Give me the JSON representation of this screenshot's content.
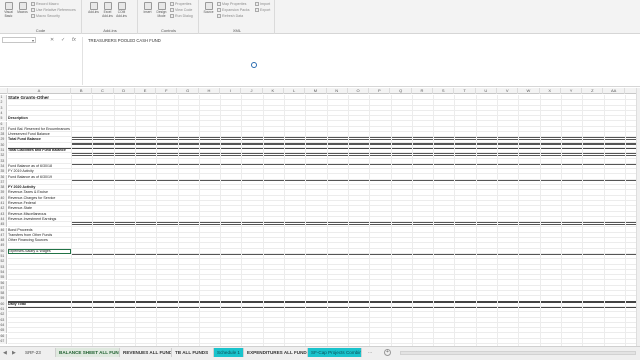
{
  "ribbon": {
    "groups": [
      {
        "name": "Code",
        "big": [
          "Visual Basic",
          "Macros"
        ],
        "small": [
          "Record Macro",
          "Use Relative References",
          "Macro Security"
        ]
      },
      {
        "name": "Add-ins",
        "big": [
          "Add-ins",
          "Excel Add-ins",
          "COM Add-ins"
        ],
        "small": []
      },
      {
        "name": "Controls",
        "big": [
          "Insert",
          "Design Mode"
        ],
        "small": [
          "Properties",
          "View Code",
          "Run Dialog"
        ]
      },
      {
        "name": "XML",
        "big": [
          "Source"
        ],
        "small": [
          "Map Properties",
          "Expansion Packs",
          "Refresh Data",
          "Import",
          "Export"
        ]
      }
    ]
  },
  "formula_bar": {
    "name_box": "",
    "cancel": "✕",
    "enter": "✓",
    "fx": "fx",
    "content": "TREASURERS POOLED CASH FUND"
  },
  "columns": [
    "A",
    "B",
    "C",
    "D",
    "E",
    "F",
    "G",
    "H",
    "I",
    "J",
    "K",
    "L",
    "M",
    "N",
    "O",
    "P",
    "Q",
    "R",
    "S",
    "T",
    "U",
    "V",
    "W",
    "X",
    "Y",
    "Z",
    "AA"
  ],
  "rows": [
    {
      "n": "1",
      "a": "State Grants-Other",
      "style": "title"
    },
    {
      "n": "2",
      "a": ""
    },
    {
      "n": "3",
      "a": ""
    },
    {
      "n": "4",
      "a": ""
    },
    {
      "n": "5",
      "a": "Description",
      "style": "bold"
    },
    {
      "n": "6",
      "a": ""
    },
    {
      "n": "27",
      "a": "Fund Bal. Reserved for Encumbrances"
    },
    {
      "n": "28",
      "a": "Unreserved Fund Balance"
    },
    {
      "n": "29",
      "a": "Total Fund Balance",
      "style": "bold"
    },
    {
      "n": "30",
      "a": ""
    },
    {
      "n": "31",
      "a": "Total Liabilities and Fund Balance",
      "style": "bold"
    },
    {
      "n": "32",
      "a": ""
    },
    {
      "n": "33",
      "a": ""
    },
    {
      "n": "34",
      "a": "Fund Balance as of 6/30/18"
    },
    {
      "n": "35",
      "a": "FY 2019 Activity"
    },
    {
      "n": "36",
      "a": "Fund Balance as of 6/30/19"
    },
    {
      "n": "37",
      "a": ""
    },
    {
      "n": "38",
      "a": "FY 2020 Activity",
      "style": "bold"
    },
    {
      "n": "39",
      "a": "Revenue-Taxes & Excise"
    },
    {
      "n": "40",
      "a": "Revenue-Charges for Service"
    },
    {
      "n": "41",
      "a": "Revenue-Federal"
    },
    {
      "n": "42",
      "a": "Revenue-State"
    },
    {
      "n": "43",
      "a": "Revenue-Miscellaneous"
    },
    {
      "n": "44",
      "a": "Revenue-Investment Earnings"
    },
    {
      "n": "45",
      "a": ""
    },
    {
      "n": "46",
      "a": "Bond Proceeds"
    },
    {
      "n": "47",
      "a": "Transfers from Other Funds"
    },
    {
      "n": "48",
      "a": "Other Financing Sources"
    },
    {
      "n": "49",
      "a": ""
    },
    {
      "n": "50",
      "a": "Expenses-Salary & Wages"
    },
    {
      "n": "51",
      "a": ""
    },
    {
      "n": "52",
      "a": ""
    },
    {
      "n": "53",
      "a": ""
    },
    {
      "n": "54",
      "a": ""
    },
    {
      "n": "55",
      "a": ""
    },
    {
      "n": "56",
      "a": ""
    },
    {
      "n": "57",
      "a": ""
    },
    {
      "n": "58",
      "a": ""
    },
    {
      "n": "59",
      "a": ""
    },
    {
      "n": "60",
      "a": "Daily Total",
      "style": "bold"
    },
    {
      "n": "61",
      "a": ""
    },
    {
      "n": "62",
      "a": ""
    },
    {
      "n": "63",
      "a": ""
    },
    {
      "n": "64",
      "a": ""
    },
    {
      "n": "65",
      "a": ""
    },
    {
      "n": "66",
      "a": ""
    },
    {
      "n": "67",
      "a": ""
    }
  ],
  "tabs": [
    {
      "label": "SRF-23",
      "style": "plain"
    },
    {
      "label": "BALANCE SHEET ALL FUNDS",
      "style": "green"
    },
    {
      "label": "REVENUES ALL FUNDS",
      "style": "bold"
    },
    {
      "label": "TB ALL FUNDS",
      "style": "bold"
    },
    {
      "label": "Schedule 1",
      "style": "cyan"
    },
    {
      "label": "EXPENDITURES ALL FUNDS",
      "style": "bold"
    },
    {
      "label": "SF-Cap Projects Combin",
      "style": "cyan"
    }
  ],
  "tab_nav": {
    "prev": "◀",
    "next": "▶",
    "more": "...",
    "add": "+"
  },
  "colors": {
    "accent": "#217346",
    "cyan_tab": "#19c3cc"
  }
}
